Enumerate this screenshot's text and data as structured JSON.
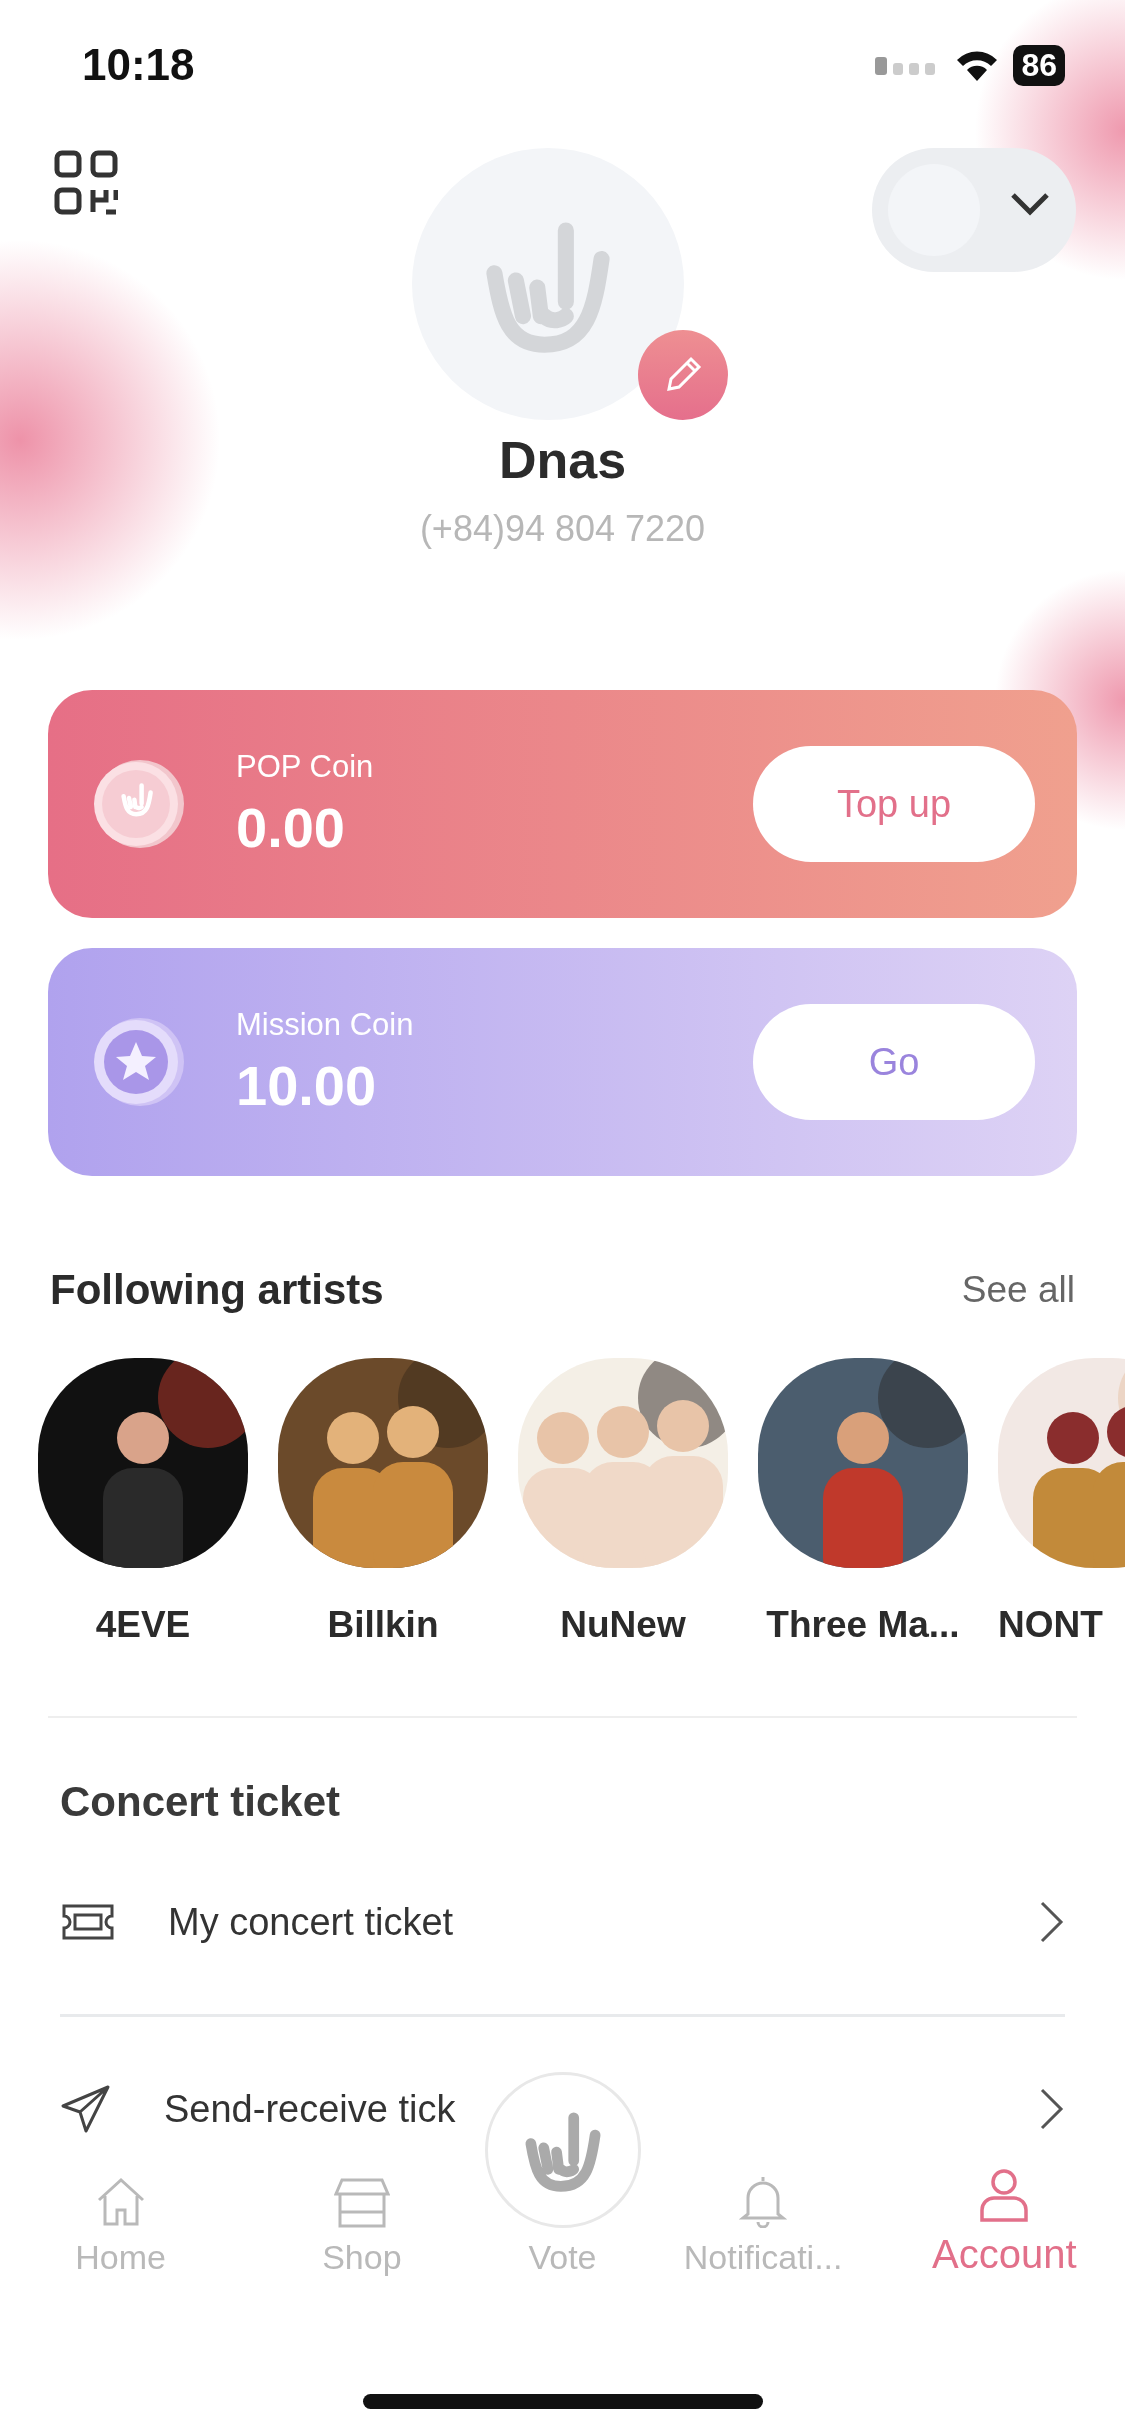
{
  "status_bar": {
    "time": "10:18",
    "battery": "86"
  },
  "profile": {
    "name": "Dnas",
    "phone": "(+84)94 804 7220",
    "toggle": {
      "on": false
    }
  },
  "wallets": [
    {
      "kind": "pop",
      "label": "POP Coin",
      "amount": "0.00",
      "button": "Top up"
    },
    {
      "kind": "mission",
      "label": "Mission Coin",
      "amount": "10.00",
      "button": "Go"
    }
  ],
  "following": {
    "title": "Following artists",
    "see_all": "See all",
    "artists": [
      {
        "name": "4EVE"
      },
      {
        "name": "Billkin"
      },
      {
        "name": "NuNew"
      },
      {
        "name": "Three Ma..."
      },
      {
        "name": "NONT"
      }
    ]
  },
  "concert": {
    "title": "Concert ticket",
    "items": [
      {
        "kind": "ticket",
        "label": "My concert ticket"
      },
      {
        "kind": "send",
        "label": "Send-receive tick"
      }
    ]
  },
  "tabs": [
    {
      "kind": "home",
      "label": "Home",
      "selected": false
    },
    {
      "kind": "shop",
      "label": "Shop",
      "selected": false
    },
    {
      "kind": "vote",
      "label": "Vote",
      "selected": false
    },
    {
      "kind": "bell",
      "label": "Notificati...",
      "selected": false
    },
    {
      "kind": "account",
      "label": "Account",
      "selected": true
    }
  ]
}
